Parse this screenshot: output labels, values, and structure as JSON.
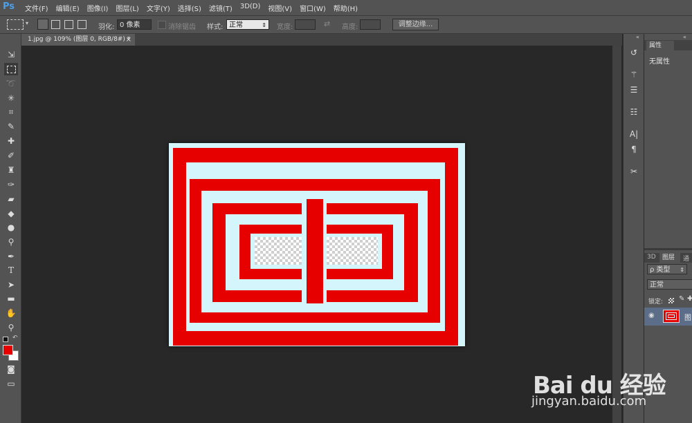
{
  "app": {
    "logo": "Ps"
  },
  "menu": [
    "文件(F)",
    "编辑(E)",
    "图像(I)",
    "图层(L)",
    "文字(Y)",
    "选择(S)",
    "滤镜(T)",
    "3D(D)",
    "视图(V)",
    "窗口(W)",
    "帮助(H)"
  ],
  "options": {
    "feather_label": "羽化:",
    "feather_value": "0 像素",
    "antialias_label": "消除锯齿",
    "style_label": "样式:",
    "style_value": "正常",
    "width_label": "宽度:",
    "height_label": "高度:",
    "refine_edge_button": "调整边缘..."
  },
  "document": {
    "tab_title": "1.jpg @ 109% (图层 0, RGB/8#) *",
    "close_glyph": "×"
  },
  "colors": {
    "foreground": "#e60000",
    "background": "#ffffff",
    "artwork_red": "#e60000",
    "artwork_bg": "#d4f5fb"
  },
  "properties_panel": {
    "tab": "属性",
    "content": "无属性"
  },
  "layers_panel": {
    "tabs": [
      "3D",
      "图层",
      "通"
    ],
    "filter_value": "ρ 类型",
    "blend_mode": "正常",
    "lock_label": "锁定:",
    "layer_name_fragment": "图"
  },
  "watermark": {
    "logo_text": "Bai du 经验",
    "url": "jingyan.baidu.com"
  }
}
